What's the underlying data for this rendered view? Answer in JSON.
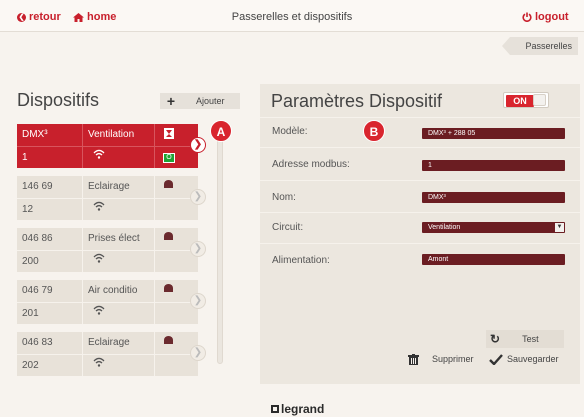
{
  "topbar": {
    "back_label": "retour",
    "home_label": "home",
    "title": "Passerelles et dispositifs",
    "logout_label": "logout"
  },
  "breadcrumb": {
    "label": "Passerelles"
  },
  "left": {
    "title": "Dispositifs",
    "add_label": "Ajouter",
    "devices": [
      {
        "ref": "DMX³",
        "name": "Ventilation",
        "address": "1",
        "status": "O"
      },
      {
        "ref": "146 69",
        "name": "Eclairage",
        "address": "12"
      },
      {
        "ref": "046 86",
        "name": "Prises élect",
        "address": "200"
      },
      {
        "ref": "046 79",
        "name": "Air conditio",
        "address": "201"
      },
      {
        "ref": "046 83",
        "name": "Eclairage",
        "address": "202"
      }
    ]
  },
  "badges": {
    "a": "A",
    "b": "B"
  },
  "right": {
    "title": "Paramètres Dispositif",
    "toggle_label": "ON",
    "fields": {
      "model_label": "Modèle:",
      "model_value": "DMX³ + 288 05",
      "modbus_label": "Adresse modbus:",
      "modbus_value": "1",
      "name_label": "Nom:",
      "name_value": "DMX³",
      "circuit_label": "Circuit:",
      "circuit_value": "Ventilation",
      "power_label": "Alimentation:",
      "power_value": "Amont"
    },
    "test_label": "Test",
    "delete_label": "Supprimer",
    "save_label": "Sauvegarder"
  },
  "footer": {
    "brand": "legrand"
  },
  "colors": {
    "accent": "#c8202c",
    "field_bg": "#6b1d22",
    "status_green": "#1fa335"
  }
}
